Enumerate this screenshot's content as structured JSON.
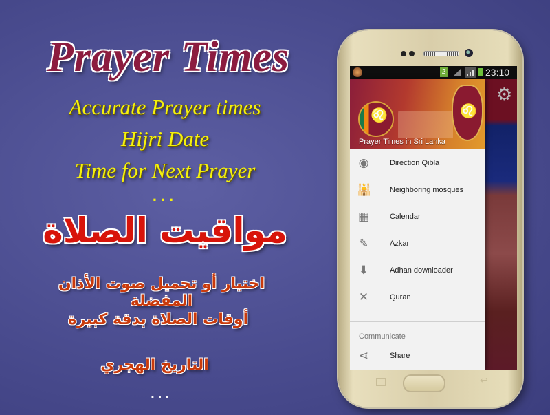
{
  "promo": {
    "title_en": "Prayer Times",
    "features_en": [
      "Accurate Prayer times",
      "Hijri Date",
      "Time for Next Prayer"
    ],
    "ellipsis_en": "...",
    "title_ar": "مواقيت الصلاة",
    "features_ar": [
      "اختيار أو تحميل صوت الأذان المفضلة",
      "أوقات الصلاة بدقة كبيرة",
      "التاريخ الهجري"
    ],
    "ellipsis_ar": "..."
  },
  "statusbar": {
    "sim": "2",
    "time": "23:10"
  },
  "drawer": {
    "header_title": "Prayer Times in Sri Lanka",
    "items": [
      {
        "label": "Direction Qibla",
        "icon": "compass-icon"
      },
      {
        "label": "Neighboring mosques",
        "icon": "mosque-icon"
      },
      {
        "label": "Calendar",
        "icon": "calendar-icon"
      },
      {
        "label": "Azkar",
        "icon": "azkar-icon"
      },
      {
        "label": "Adhan downloader",
        "icon": "download-icon"
      },
      {
        "label": "Quran",
        "icon": "quran-icon"
      }
    ],
    "section_label": "Communicate",
    "share": {
      "label": "Share",
      "icon": "share-icon"
    }
  }
}
